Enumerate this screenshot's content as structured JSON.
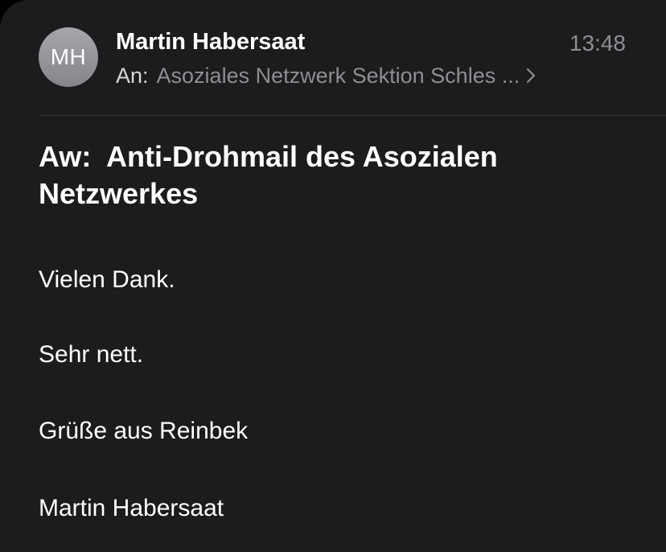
{
  "header": {
    "avatar_initials": "MH",
    "sender_name": "Martin Habersaat",
    "time": "13:48",
    "to_label": "An:",
    "to_value": "Asoziales Netzwerk Sektion Schles ..."
  },
  "subject": "Aw:  Anti-Drohmail des Asozialen Netzwerkes",
  "body": {
    "line1": "Vielen Dank.",
    "line2": "Sehr nett.",
    "line3": "Grüße aus Reinbek",
    "line4": "Martin Habersaat"
  },
  "colors": {
    "background": "#1c1c1e",
    "secondary_text": "#8e8e93",
    "divider": "#3a3a3c"
  }
}
